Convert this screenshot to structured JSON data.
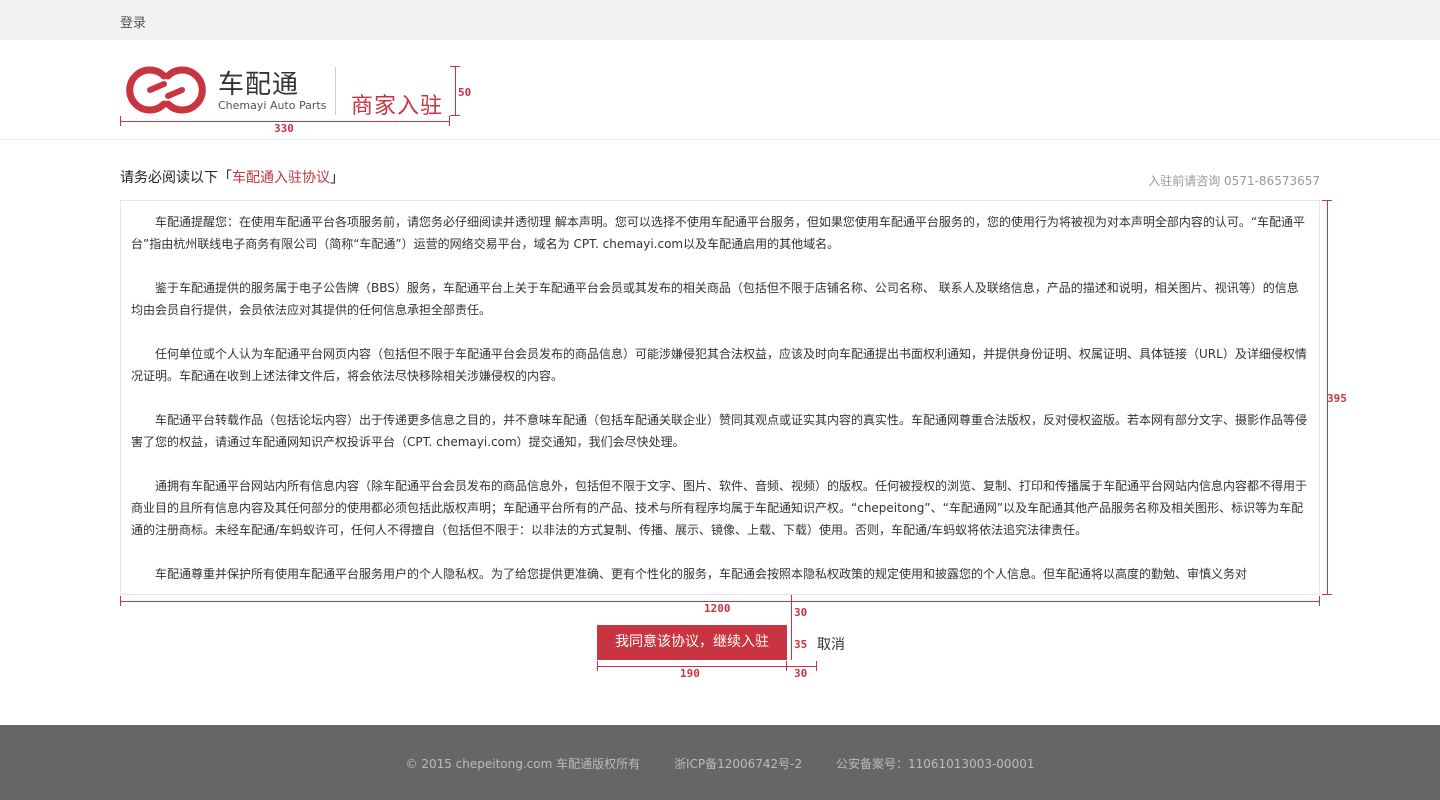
{
  "topbar": {
    "login": "登录"
  },
  "header": {
    "logo_cn": "车配通",
    "logo_en": "Chemayi Auto Parts",
    "merchant": "商家入驻"
  },
  "annotations": {
    "logo_width": "330",
    "logo_height": "50",
    "box_width": "1200",
    "box_height": "395",
    "gap": "30",
    "button_height": "35",
    "button_width": "190",
    "cancel_gap": "30"
  },
  "notice": {
    "prefix": "请务必阅读以下「",
    "link": "车配通入驻协议",
    "suffix": "」"
  },
  "hotline": "入驻前请咨询 0571-86573657",
  "agreement": {
    "paragraphs": [
      "车配通提醒您：在使用车配通平台各项服务前，请您务必仔细阅读并透彻理 解本声明。您可以选择不使用车配通平台服务，但如果您使用车配通平台服务的，您的使用行为将被视为对本声明全部内容的认可。“车配通平台”指由杭州联线电子商务有限公司（简称“车配通”）运营的网络交易平台，域名为 CPT. chemayi.com以及车配通启用的其他域名。",
      "鉴于车配通提供的服务属于电子公告牌（BBS）服务，车配通平台上关于车配通平台会员或其发布的相关商品（包括但不限于店铺名称、公司名称、 联系人及联络信息，产品的描述和说明，相关图片、视讯等）的信息均由会员自行提供，会员依法应对其提供的任何信息承担全部责任。",
      "任何单位或个人认为车配通平台网页内容（包括但不限于车配通平台会员发布的商品信息）可能涉嫌侵犯其合法权益，应该及时向车配通提出书面权利通知，并提供身份证明、权属证明、具体链接（URL）及详细侵权情况证明。车配通在收到上述法律文件后，将会依法尽快移除相关涉嫌侵权的内容。",
      "车配通平台转载作品（包括论坛内容）出于传递更多信息之目的，并不意味车配通（包括车配通关联企业）赞同其观点或证实其内容的真实性。车配通网尊重合法版权，反对侵权盗版。若本网有部分文字、摄影作品等侵害了您的权益，请通过车配通网知识产权投诉平台（CPT. chemayi.com）提交通知，我们会尽快处理。",
      "通拥有车配通平台网站内所有信息内容（除车配通平台会员发布的商品信息外，包括但不限于文字、图片、软件、音频、视频）的版权。任何被授权的浏览、复制、打印和传播属于车配通平台网站内信息内容都不得用于商业目的且所有信息内容及其任何部分的使用都必须包括此版权声明；车配通平台所有的产品、技术与所有程序均属于车配通知识产权。“chepeitong”、“车配通网”以及车配通其他产品服务名称及相关图形、标识等为车配通的注册商标。未经车配通/车蚂蚁许可，任何人不得擅自（包括但不限于：以非法的方式复制、传播、展示、镜像、上载、下载）使用。否则，车配通/车蚂蚁将依法追究法律责任。",
      "车配通尊重并保护所有使用车配通平台服务用户的个人隐私权。为了给您提供更准确、更有个性化的服务，车配通会按照本隐私权政策的规定使用和披露您的个人信息。但车配通将以高度的勤勉、审慎义务对"
    ]
  },
  "buttons": {
    "agree": "我同意该协议，继续入驻",
    "cancel": "取消"
  },
  "footer": {
    "copyright": "© 2015 chepeitong.com 车配通版权所有",
    "icp": "浙ICP备12006742号-2",
    "police": "公安备案号：11061013003-00001"
  },
  "colors": {
    "brand": "#c8343f",
    "footer_bg": "#666666",
    "topbar_bg": "#f2f2f2"
  }
}
